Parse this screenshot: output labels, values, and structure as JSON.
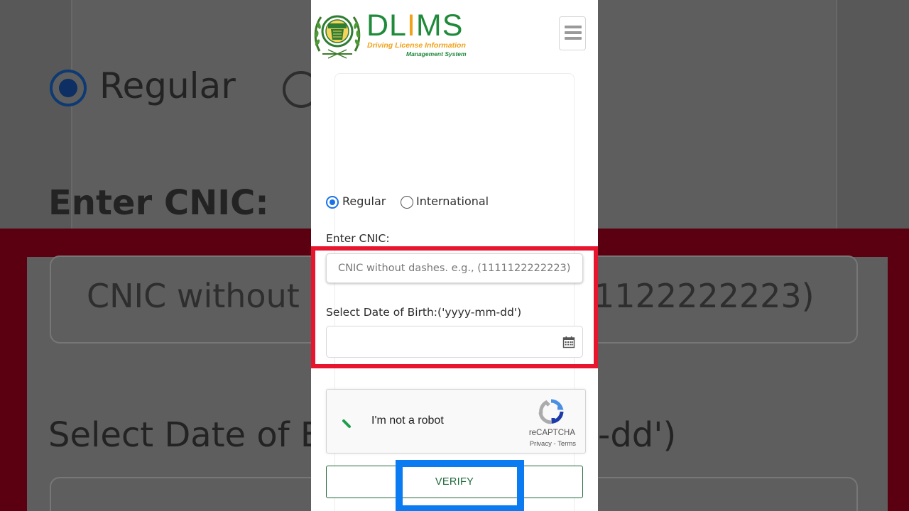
{
  "colors": {
    "brand_green": "#1f8a3a",
    "brand_orange": "#f2a21a",
    "highlight_red": "#e8152e",
    "highlight_blue": "#0a7bf0",
    "radio_blue": "#1a73e8",
    "verify_green": "#1f6a3c"
  },
  "header": {
    "logo_icon": "punjab-seal-icon",
    "brand_prefix": "DL",
    "brand_i": "I",
    "brand_suffix": "MS",
    "brand_line1": "Driving License Information",
    "brand_line2": "Management System",
    "menu_icon": "hamburger-menu-icon"
  },
  "form": {
    "license_type": {
      "options": [
        {
          "label": "Regular",
          "selected": true
        },
        {
          "label": "International",
          "selected": false
        }
      ]
    },
    "cnic_label": "Enter CNIC:",
    "cnic_placeholder": "CNIC without dashes. e.g., (1111122222223)",
    "cnic_value": "",
    "dob_label": "Select Date of Birth:('yyyy-mm-dd')",
    "dob_value": "",
    "dob_icon": "calendar-icon",
    "captcha": {
      "label": "I'm not a robot",
      "brand": "reCAPTCHA",
      "privacy": "Privacy",
      "separator": "-",
      "terms": "Terms",
      "state": "loading",
      "icon": "recaptcha-logo-icon"
    },
    "verify_label": "VERIFY"
  },
  "background_zoom": {
    "regular": "Regular",
    "cnic_label": "Enter CNIC:",
    "placeholder_left": "CNIC without",
    "placeholder_right": "1122222223)",
    "dob_left": "Select Date of E",
    "dob_right": "-dd')"
  }
}
